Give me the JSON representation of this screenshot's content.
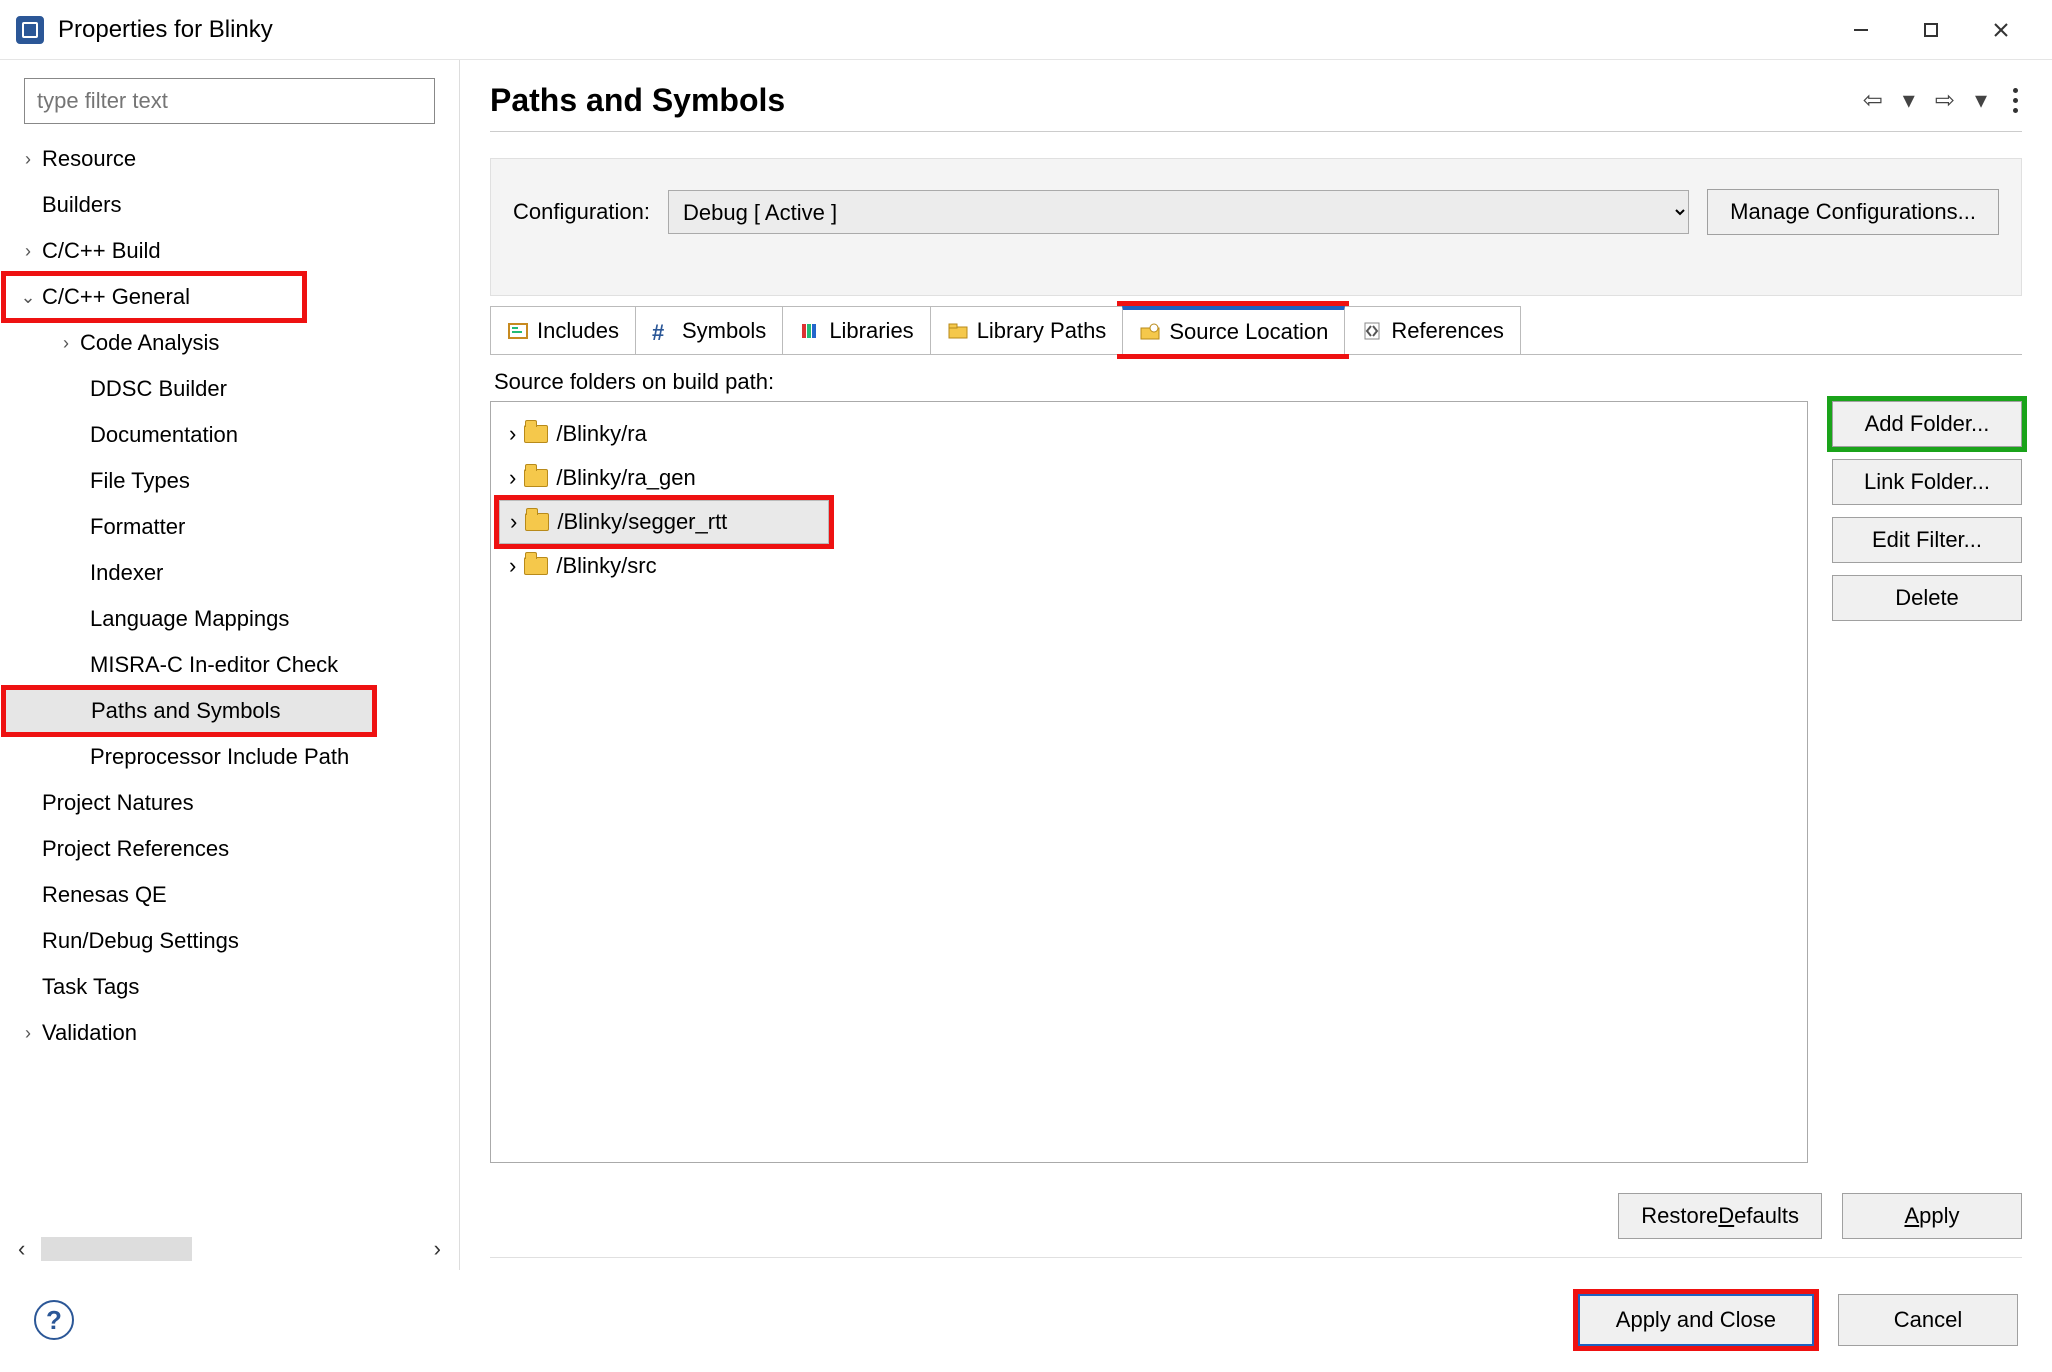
{
  "window": {
    "title": "Properties for Blinky"
  },
  "filter": {
    "placeholder": "type filter text"
  },
  "tree": {
    "resource": "Resource",
    "builders": "Builders",
    "cbuild": "C/C++ Build",
    "cgeneral": "C/C++ General",
    "codeanalysis": "Code Analysis",
    "ddsc": "DDSC Builder",
    "documentation": "Documentation",
    "filetypes": "File Types",
    "formatter": "Formatter",
    "indexer": "Indexer",
    "langmap": "Language Mappings",
    "misra": "MISRA-C In-editor Check",
    "paths": "Paths and Symbols",
    "preproc": "Preprocessor Include Path",
    "projnatures": "Project Natures",
    "projrefs": "Project References",
    "renesas": "Renesas QE",
    "rundebug": "Run/Debug Settings",
    "tasktags": "Task Tags",
    "validation": "Validation"
  },
  "header": {
    "title": "Paths and Symbols"
  },
  "config": {
    "label": "Configuration:",
    "value": "Debug  [ Active ]",
    "manage": "Manage Configurations..."
  },
  "tabs": {
    "includes": "Includes",
    "symbols": "Symbols",
    "libraries": "Libraries",
    "libpaths": "Library Paths",
    "srcloc": "Source Location",
    "refs": "References"
  },
  "src": {
    "label": "Source folders on build path:",
    "items": [
      "/Blinky/ra",
      "/Blinky/ra_gen",
      "/Blinky/segger_rtt",
      "/Blinky/src"
    ],
    "addfolder": "Add Folder...",
    "linkfolder": "Link Folder...",
    "editfilter": "Edit Filter...",
    "delete": "Delete"
  },
  "buttons": {
    "restore_pre": "Restore ",
    "restore_u": "D",
    "restore_post": "efaults",
    "apply_u": "A",
    "apply_post": "pply",
    "applyclose": "Apply and Close",
    "cancel": "Cancel"
  }
}
